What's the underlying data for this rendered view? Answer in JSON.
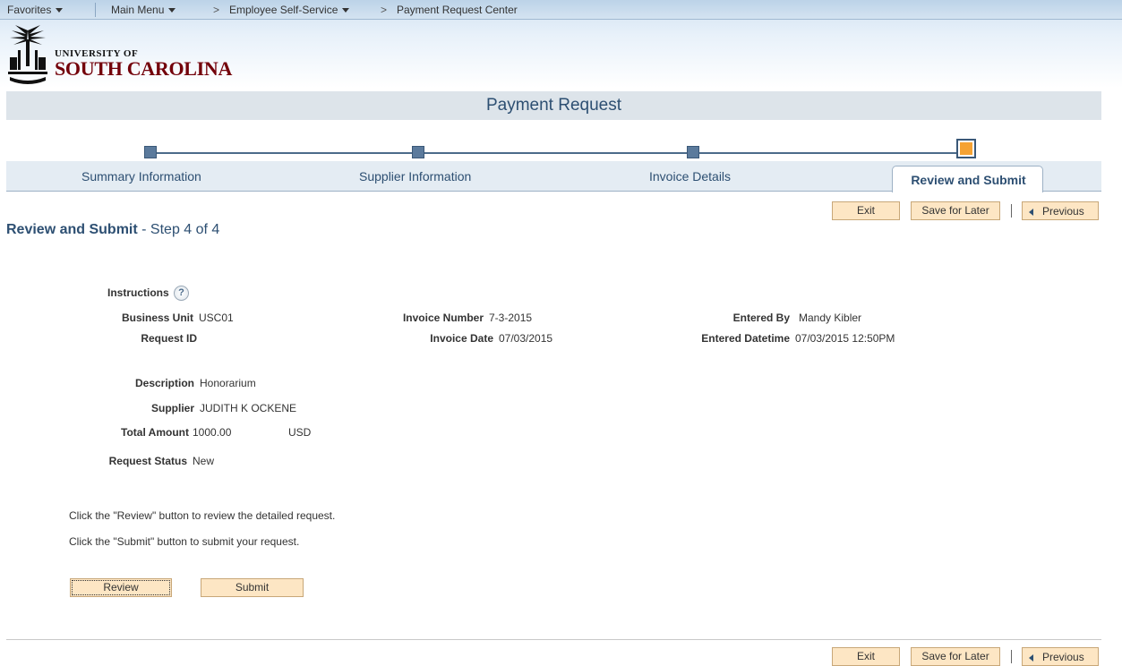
{
  "nav": {
    "favorites": "Favorites",
    "main_menu": "Main Menu",
    "breadcrumb_sep": ">",
    "ess": "Employee Self-Service",
    "current": "Payment Request Center"
  },
  "logo": {
    "univ": "UNIVERSITY OF",
    "name": "SOUTH CAROLINA"
  },
  "page": {
    "title": "Payment Request"
  },
  "steps": [
    {
      "label": "Summary Information"
    },
    {
      "label": "Supplier Information"
    },
    {
      "label": "Invoice Details"
    },
    {
      "label": "Review and Submit",
      "active": true
    }
  ],
  "toolbar": {
    "exit": "Exit",
    "save": "Save for Later",
    "previous": "Previous"
  },
  "section": {
    "title": "Review and Submit",
    "subtitle": " - Step 4 of 4"
  },
  "fields": {
    "instructions_label": "Instructions",
    "help": "?",
    "business_unit_label": "Business Unit",
    "business_unit": "USC01",
    "request_id_label": "Request ID",
    "invoice_number_label": "Invoice Number",
    "invoice_number": "7-3-2015",
    "invoice_date_label": "Invoice Date",
    "invoice_date": "07/03/2015",
    "entered_by_label": "Entered By",
    "entered_by": "Mandy Kibler",
    "entered_datetime_label": "Entered Datetime",
    "entered_datetime": "07/03/2015 12:50PM",
    "description_label": "Description",
    "description": "Honorarium",
    "supplier_label": "Supplier",
    "supplier": "JUDITH K OCKENE",
    "total_amount_label": "Total Amount",
    "total_amount": "1000.00",
    "currency": "USD",
    "request_status_label": "Request Status",
    "request_status": "New"
  },
  "notes": {
    "review": "Click the \"Review\" button to review the detailed request.",
    "submit": "Click the \"Submit\" button to submit your request."
  },
  "actions": {
    "review": "Review",
    "submit": "Submit"
  }
}
